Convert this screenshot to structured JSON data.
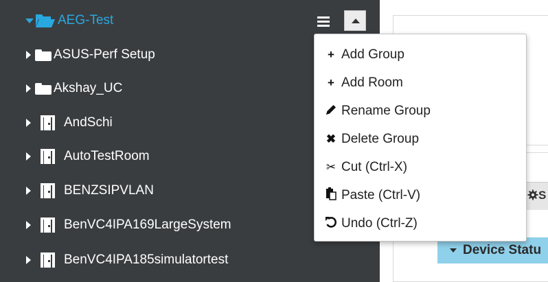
{
  "tree": {
    "root": {
      "label": "AEG-Test",
      "icon": "folder-open-icon",
      "color": "#29a8e0"
    },
    "items": [
      {
        "label": "ASUS-Perf Setup",
        "icon": "folder-icon"
      },
      {
        "label": "Akshay_UC",
        "icon": "folder-icon"
      },
      {
        "label": "AndSchi",
        "icon": "room-door-icon"
      },
      {
        "label": "AutoTestRoom",
        "icon": "room-door-icon"
      },
      {
        "label": "BENZSIPVLAN",
        "icon": "room-door-icon"
      },
      {
        "label": "BenVC4IPA169LargeSystem",
        "icon": "room-door-icon"
      },
      {
        "label": "BenVC4IPA185simulatortest",
        "icon": "room-door-icon"
      }
    ]
  },
  "context_menu": {
    "items": [
      {
        "label": "Add Group",
        "icon": "plus-icon"
      },
      {
        "label": "Add Room",
        "icon": "plus-icon"
      },
      {
        "label": "Rename Group",
        "icon": "pencil-icon"
      },
      {
        "label": "Delete Group",
        "icon": "times-icon"
      },
      {
        "label": "Cut (Ctrl-X)",
        "icon": "scissors-icon"
      },
      {
        "label": "Paste (Ctrl-V)",
        "icon": "paste-icon"
      },
      {
        "label": "Undo (Ctrl-Z)",
        "icon": "undo-icon"
      }
    ]
  },
  "right_panel": {
    "tab_partial": "S",
    "device_status": "Device Statu"
  },
  "colors": {
    "sidebar_bg": "#3a3d40",
    "accent": "#29a8e0",
    "device_status_bg": "#8fd0ea"
  }
}
